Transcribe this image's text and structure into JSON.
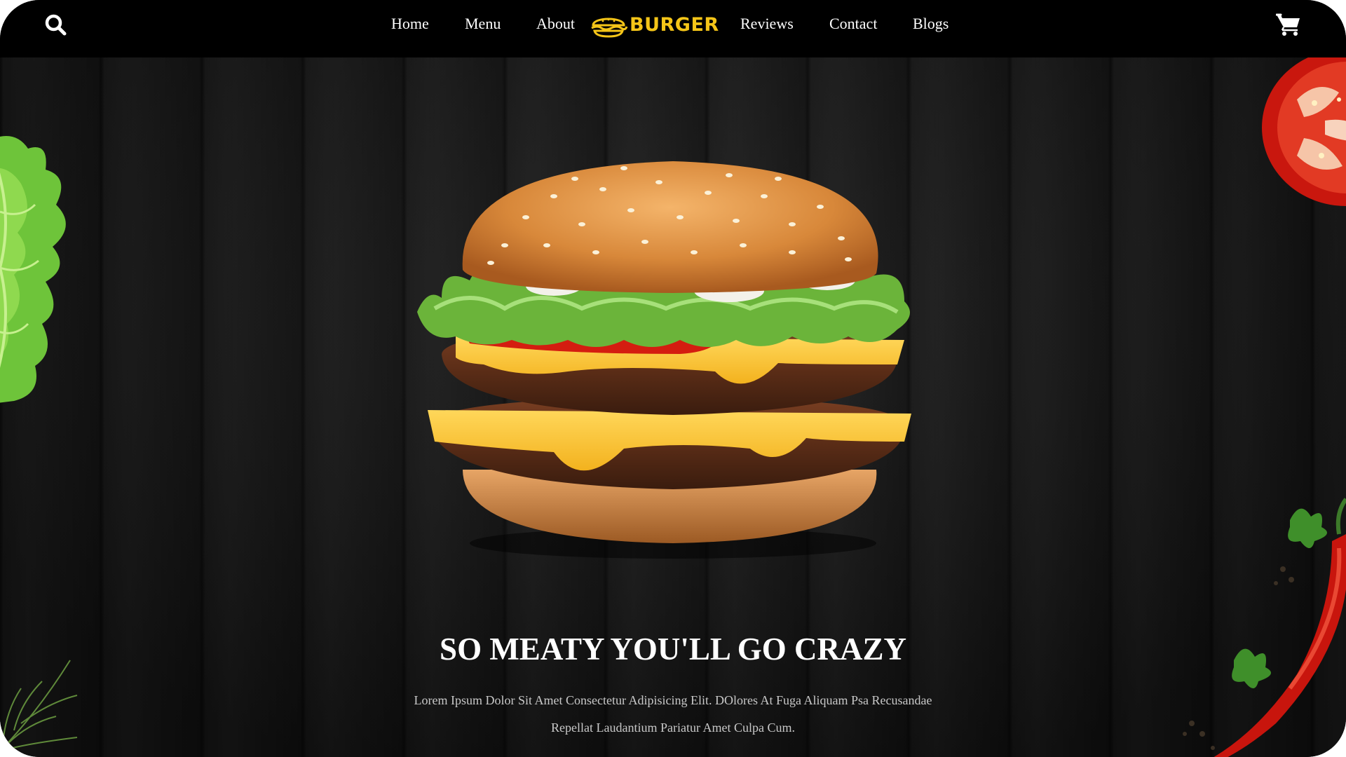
{
  "nav": {
    "links_left": [
      "Home",
      "Menu",
      "About"
    ],
    "links_right": [
      "Reviews",
      "Contact",
      "Blogs"
    ],
    "logo_text": "BURGER",
    "search_icon": "search-icon",
    "cart_icon": "shopping-cart-icon"
  },
  "hero": {
    "headline": "SO MEATY YOU'LL GO CRAZY",
    "subtext_line1": "Lorem Ipsum Dolor Sit Amet Consectetur Adipisicing Elit. DOlores At Fuga Aliquam Psa Recusandae",
    "subtext_line2": "Repellat Laudantium Pariatur Amet Culpa Cum."
  },
  "colors": {
    "nav_bg": "#000000",
    "accent": "#f5c518",
    "hero_bg": "#1b1b1b",
    "text": "#ffffff",
    "subtext": "#c8c8c8"
  }
}
